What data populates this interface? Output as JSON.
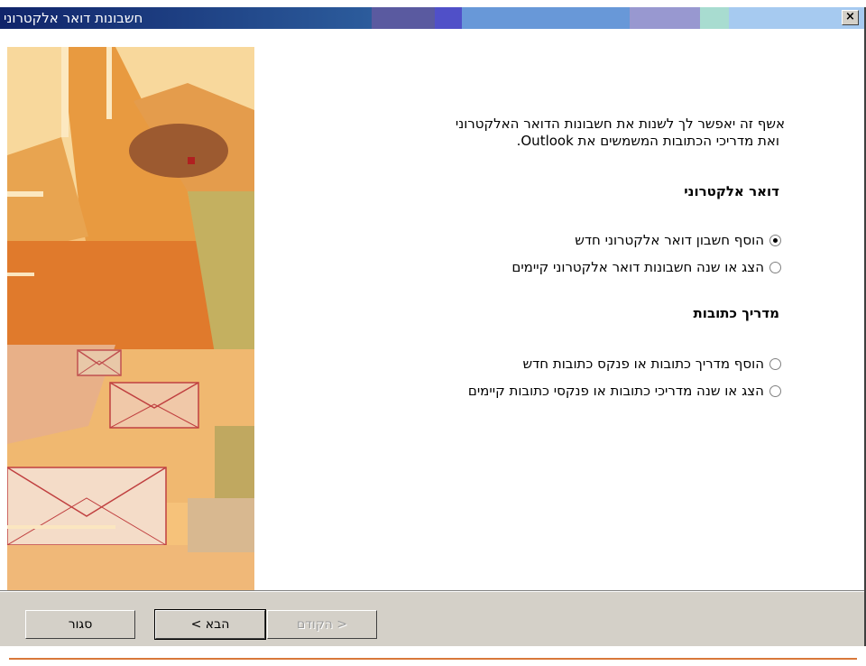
{
  "window": {
    "title": "חשבונות דואר אלקטרוני",
    "close_label": "×",
    "titlebar_colors": [
      "#10246a",
      "#2c4c8c",
      "#5a5aa0",
      "#5050c8",
      "#6898d8",
      "#9898d0",
      "#a8dcd0",
      "#a6caf0"
    ]
  },
  "content": {
    "intro_line1": "אשף זה יאפשר לך לשנות את חשבונות הדואר האלקטרוני",
    "intro_line2": "ואת מדריכי הכתובות המשמשים את Outlook.",
    "email_section": {
      "heading": "דואר אלקטרוני",
      "options": [
        {
          "label": "הוסף חשבון דואר אלקטרוני חדש",
          "checked": true
        },
        {
          "label": "הצג או שנה חשבונות דואר אלקטרוני קיימים",
          "checked": false
        }
      ]
    },
    "directory_section": {
      "heading": "מדריך כתובות",
      "options": [
        {
          "label": "הוסף מדריך כתובות או פנקס כתובות חדש",
          "checked": false
        },
        {
          "label": "הצג או שנה מדריכי כתובות או פנקסי כתובות קיימים",
          "checked": false
        }
      ]
    }
  },
  "buttons": {
    "close_label": "סגור",
    "next_label": "הבא >",
    "back_label": "< הקודם"
  }
}
